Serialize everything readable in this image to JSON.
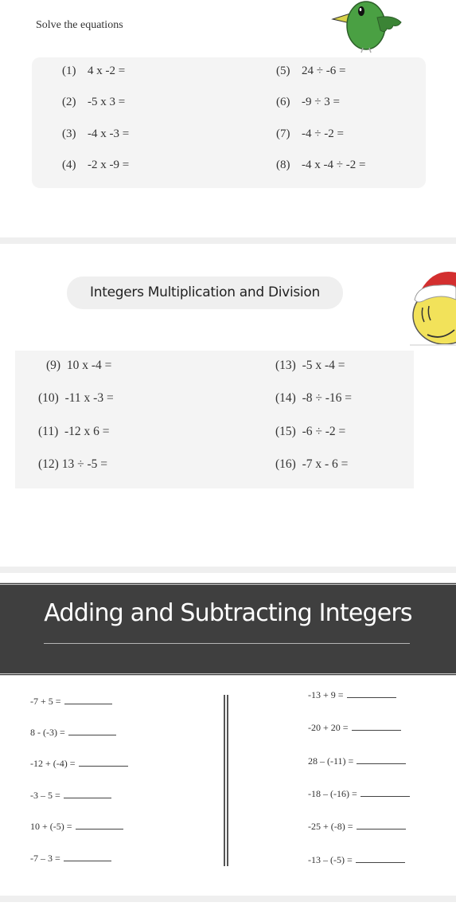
{
  "section1": {
    "title": "Solve the equations",
    "mascot": "green-bird-icon",
    "left_column": [
      {
        "num": "(1)",
        "expr": "4 x -2 ="
      },
      {
        "num": "(2)",
        "expr": "-5 x 3 ="
      },
      {
        "num": "(3)",
        "expr": "-4 x -3 ="
      },
      {
        "num": "(4)",
        "expr": "-2 x -9 ="
      }
    ],
    "right_column": [
      {
        "num": "(5)",
        "expr": "24 ÷ -6 ="
      },
      {
        "num": "(6)",
        "expr": "-9 ÷ 3 ="
      },
      {
        "num": "(7)",
        "expr": "-4 ÷ -2 ="
      },
      {
        "num": "(8)",
        "expr": "-4 x -4 ÷ -2 ="
      }
    ]
  },
  "section2": {
    "title": "Integers  Multiplication and Division",
    "mascot": "santa-smiley-icon",
    "left_column": [
      {
        "num": "(9)",
        "expr": "10 x -4 ="
      },
      {
        "num": "(10)",
        "expr": "-11 x -3 ="
      },
      {
        "num": "(11)",
        "expr": "-12 x 6 ="
      },
      {
        "num": "(12)",
        "expr": "13 ÷ -5 ="
      }
    ],
    "right_column": [
      {
        "num": "(13)",
        "expr": "-5 x -4 ="
      },
      {
        "num": "(14)",
        "expr": "-8 ÷ -16 ="
      },
      {
        "num": "(15)",
        "expr": "-6 ÷ -2 ="
      },
      {
        "num": "(16)",
        "expr": "-7 x - 6 ="
      }
    ]
  },
  "section3": {
    "title": "Adding and Subtracting Integers",
    "left_column": [
      "-7 + 5 =",
      "8 - (-3) =",
      "-12 + (-4) =",
      "-3 – 5 =",
      "10 + (-5) =",
      "-7 – 3 ="
    ],
    "right_column": [
      "-13 + 9 =",
      "-20 + 20 =",
      "28 – (-11) =",
      "-18 – (-16) =",
      "-25 + (-8) =",
      "-13 – (-5) ="
    ]
  }
}
